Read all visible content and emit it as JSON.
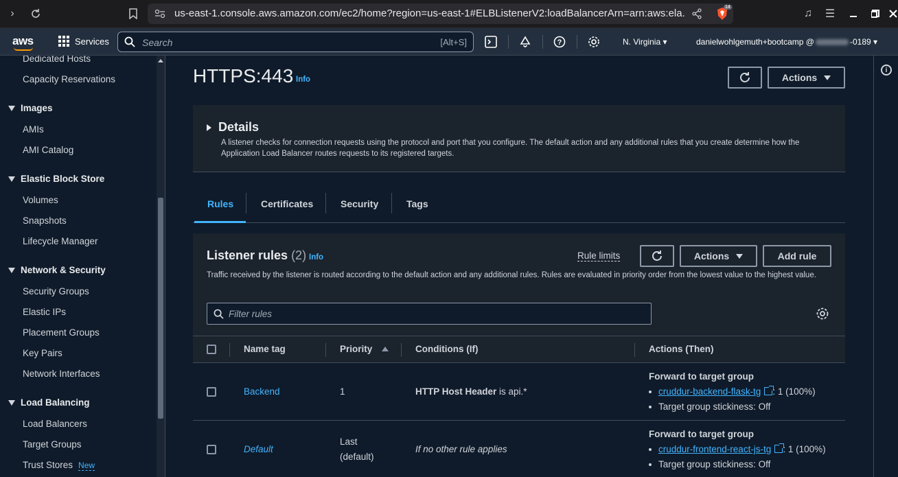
{
  "browser": {
    "url": "us-east-1.console.aws.amazon.com/ec2/home?region=us-east-1#ELBListenerV2:loadBalancerArn=arn:aws:ela...",
    "shield_count": "14"
  },
  "topnav": {
    "logo": "aws",
    "services": "Services",
    "search_placeholder": "Search",
    "search_shortcut": "[Alt+S]",
    "region": "N. Virginia",
    "account_prefix": "danielwohlgemuth+bootcamp @",
    "account_suffix": "-0189"
  },
  "sidebar": {
    "items_top": [
      {
        "label": "Dedicated Hosts"
      },
      {
        "label": "Capacity Reservations"
      }
    ],
    "sections": [
      {
        "title": "Images",
        "items": [
          "AMIs",
          "AMI Catalog"
        ]
      },
      {
        "title": "Elastic Block Store",
        "items": [
          "Volumes",
          "Snapshots",
          "Lifecycle Manager"
        ]
      },
      {
        "title": "Network & Security",
        "items": [
          "Security Groups",
          "Elastic IPs",
          "Placement Groups",
          "Key Pairs",
          "Network Interfaces"
        ]
      },
      {
        "title": "Load Balancing",
        "items": [
          "Load Balancers",
          "Target Groups",
          "Trust Stores"
        ]
      }
    ],
    "new_badge": "New"
  },
  "page": {
    "title": "HTTPS:443",
    "info": "Info",
    "actions": "Actions"
  },
  "details": {
    "title": "Details",
    "text": "A listener checks for connection requests using the protocol and port that you configure. The default action and any additional rules that you create determine how the Application Load Balancer routes requests to its registered targets."
  },
  "tabs": [
    "Rules",
    "Certificates",
    "Security",
    "Tags"
  ],
  "rules": {
    "title": "Listener rules",
    "count": "(2)",
    "info": "Info",
    "rule_limits": "Rule limits",
    "actions": "Actions",
    "add_rule": "Add rule",
    "description": "Traffic received by the listener is routed according to the default action and any additional rules. Rules are evaluated in priority order from the lowest value to the highest value.",
    "filter_placeholder": "Filter rules",
    "columns": [
      "Name tag",
      "Priority",
      "Conditions (If)",
      "Actions (Then)"
    ],
    "rows": [
      {
        "name": "Backend",
        "priority": "1",
        "priority2": "",
        "condition_bold": "HTTP Host Header",
        "condition_rest": " is api.*",
        "action_title": "Forward to target group",
        "target": "cruddur-backend-flask-tg",
        "target_weight": ": 1 (100%)",
        "stickiness": "Target group stickiness: Off"
      },
      {
        "name": "Default",
        "priority": "Last",
        "priority2": "(default)",
        "condition_bold": "",
        "condition_rest": "If no other rule applies",
        "action_title": "Forward to target group",
        "target": "cruddur-frontend-react-js-tg",
        "target_weight": ": 1 (100%)",
        "stickiness": "Target group stickiness: Off"
      }
    ]
  },
  "colors": {
    "accent": "#42b4ff",
    "nav_bg": "#232f3e",
    "page_bg": "#0f1b2a",
    "aws_orange": "#ff9900"
  }
}
